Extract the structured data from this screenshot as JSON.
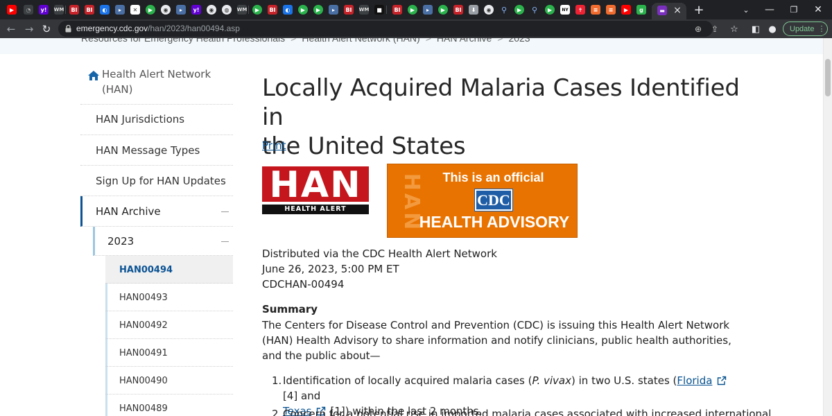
{
  "browser": {
    "url_host": "emergency.cdc.gov",
    "url_path": "/han/2023/han00494.asp",
    "active_tab_close": "×",
    "new_tab": "+",
    "update_label": "Update",
    "tab_favicons": [
      "BI",
      "BI",
      "BI",
      "BI",
      "BI",
      "BI"
    ],
    "colors": {
      "tabstrip": "#202124",
      "toolbar": "#35363a",
      "update": "#81c995"
    }
  },
  "breadcrumb": {
    "items": [
      "Resources for Emergency Health Professionals",
      "Health Alert Network (HAN)",
      "HAN Archive",
      "2023"
    ],
    "separator": ">"
  },
  "sidebar": {
    "home_line1": "Health Alert Network",
    "home_line2": "(HAN)",
    "items": [
      {
        "label": "HAN Jurisdictions"
      },
      {
        "label": "HAN Message Types"
      },
      {
        "label": "Sign Up for HAN Updates"
      },
      {
        "label": "HAN Archive"
      }
    ],
    "year": "2023",
    "sub_items": [
      {
        "label": "HAN00494",
        "active": true
      },
      {
        "label": "HAN00493"
      },
      {
        "label": "HAN00492"
      },
      {
        "label": "HAN00491"
      },
      {
        "label": "HAN00490"
      },
      {
        "label": "HAN00489"
      }
    ],
    "accent_color": "#0b5394"
  },
  "article": {
    "title_line1": "Locally Acquired Malaria Cases Identified in",
    "title_line2": "the United States",
    "print_label": "Print",
    "han_logo_letters": "HAN",
    "han_logo_sub": "HEALTH ALERT NETWORK",
    "advisory_vertical": "HAN",
    "advisory_line1": "This is an official",
    "advisory_cdc": "CDC",
    "advisory_line2": "HEALTH ADVISORY",
    "distributed": "Distributed via the CDC Health Alert Network",
    "date": "June 26, 2023, 5:00 PM ET",
    "id": "CDCHAN-00494",
    "summary_heading": "Summary",
    "summary_text": "The Centers for Disease Control and Prevention (CDC) is issuing this Health Alert Network (HAN) Health Advisory to share information and notify clinicians, public health authorities, and the public about—",
    "list": [
      {
        "num": "1.",
        "pre": "Identification of locally acquired malaria cases (",
        "italic": "P. vivax",
        "mid": ") in two U.S. states (",
        "link1": "Florida",
        "ref1": "[4] and",
        "link2": "Texas",
        "ref2": "[1]) within the last 2 months,"
      },
      {
        "num": "2.",
        "text": "Concern for a potential rise in imported malaria cases associated with increased international"
      }
    ]
  }
}
